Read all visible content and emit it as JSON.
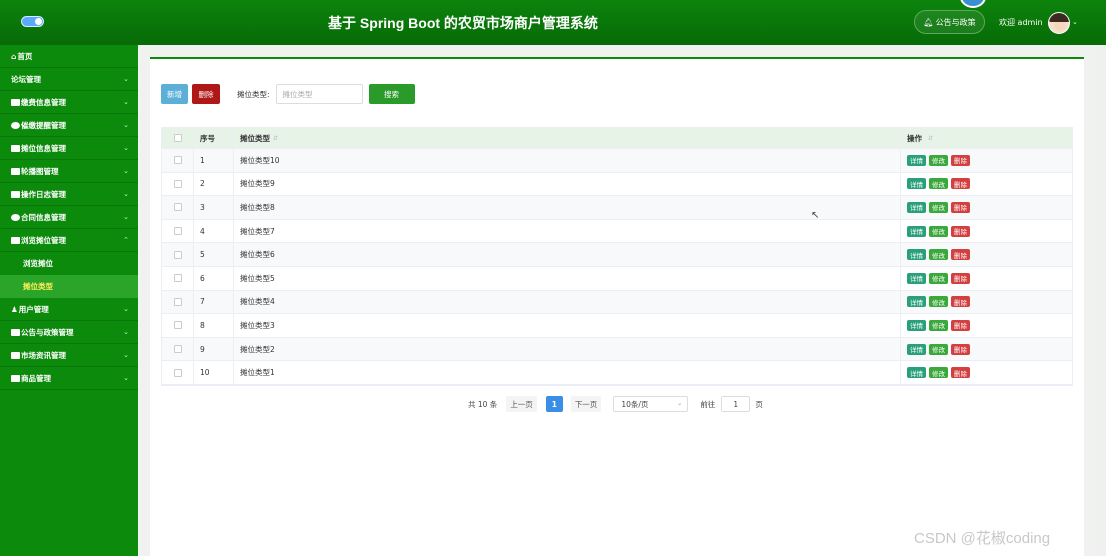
{
  "header": {
    "title": "基于 Spring Boot 的农贸市场商户管理系统",
    "notice_label": "公告与政策",
    "welcome": "欢迎 admin"
  },
  "sidebar": {
    "items": [
      {
        "label": "首页",
        "icon": "home-icon"
      },
      {
        "label": "论坛管理",
        "icon": ""
      },
      {
        "label": "缴费信息管理",
        "icon": "money-icon"
      },
      {
        "label": "催缴提醒管理",
        "icon": "bell-icon"
      },
      {
        "label": "摊位信息管理",
        "icon": "store-icon"
      },
      {
        "label": "轮播图管理",
        "icon": "image-icon"
      },
      {
        "label": "操作日志管理",
        "icon": "log-icon"
      },
      {
        "label": "合同信息管理",
        "icon": "contract-icon"
      },
      {
        "label": "浏览摊位管理",
        "icon": "browse-icon"
      }
    ],
    "subitems": [
      {
        "label": "浏览摊位"
      },
      {
        "label": "摊位类型"
      }
    ],
    "items_after": [
      {
        "label": "用户管理",
        "icon": "user-icon"
      },
      {
        "label": "公告与政策管理",
        "icon": "notice-icon"
      },
      {
        "label": "市场资讯管理",
        "icon": "news-icon"
      },
      {
        "label": "商品管理",
        "icon": "goods-icon"
      }
    ]
  },
  "toolbar": {
    "add_label": "新增",
    "delete_label": "删除",
    "filter_label": "摊位类型:",
    "filter_placeholder": "摊位类型",
    "search_label": "搜索"
  },
  "table": {
    "headers": {
      "index": "序号",
      "type": "摊位类型",
      "actions": "操作"
    },
    "rows": [
      {
        "index": "1",
        "type": "摊位类型10"
      },
      {
        "index": "2",
        "type": "摊位类型9"
      },
      {
        "index": "3",
        "type": "摊位类型8"
      },
      {
        "index": "4",
        "type": "摊位类型7"
      },
      {
        "index": "5",
        "type": "摊位类型6"
      },
      {
        "index": "6",
        "type": "摊位类型5"
      },
      {
        "index": "7",
        "type": "摊位类型4"
      },
      {
        "index": "8",
        "type": "摊位类型3"
      },
      {
        "index": "9",
        "type": "摊位类型2"
      },
      {
        "index": "10",
        "type": "摊位类型1"
      }
    ],
    "action_labels": {
      "detail": "详情",
      "edit": "修改",
      "remove": "删除"
    }
  },
  "pagination": {
    "total": "共 10 条",
    "prev": "上一页",
    "current": "1",
    "next": "下一页",
    "page_size": "10条/页",
    "goto_label": "前往",
    "goto_value": "1",
    "page_unit": "页"
  },
  "watermark": "CSDN @花椒coding",
  "colors": {
    "primary": "#0b8a0b",
    "active_sub": "#2aa52a",
    "active_text": "#ffee55",
    "page_blue": "#3a8ee6"
  }
}
